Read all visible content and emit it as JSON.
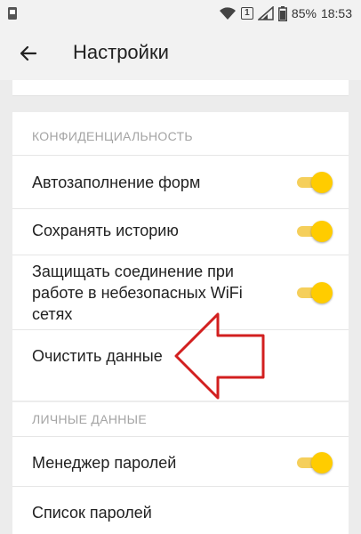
{
  "status_bar": {
    "battery": "85%",
    "time": "18:53",
    "sim_badge": "1"
  },
  "app_bar": {
    "title": "Настройки"
  },
  "privacy": {
    "header": "КОНФИДЕНЦИАЛЬНОСТЬ",
    "items": [
      {
        "label": "Автозаполнение форм",
        "toggle": true
      },
      {
        "label": "Сохранять историю",
        "toggle": true
      },
      {
        "label": "Защищать соединение при работе в небезопасных WiFi сетях",
        "toggle": true
      },
      {
        "label": "Очистить данные"
      }
    ]
  },
  "personal": {
    "header": "ЛИЧНЫЕ ДАННЫЕ",
    "items": [
      {
        "label": "Менеджер паролей",
        "toggle": true
      },
      {
        "label": "Список паролей"
      }
    ]
  },
  "colors": {
    "accent": "#ffcc00",
    "annotation_arrow": "#d21f1f",
    "background": "#ececec"
  }
}
